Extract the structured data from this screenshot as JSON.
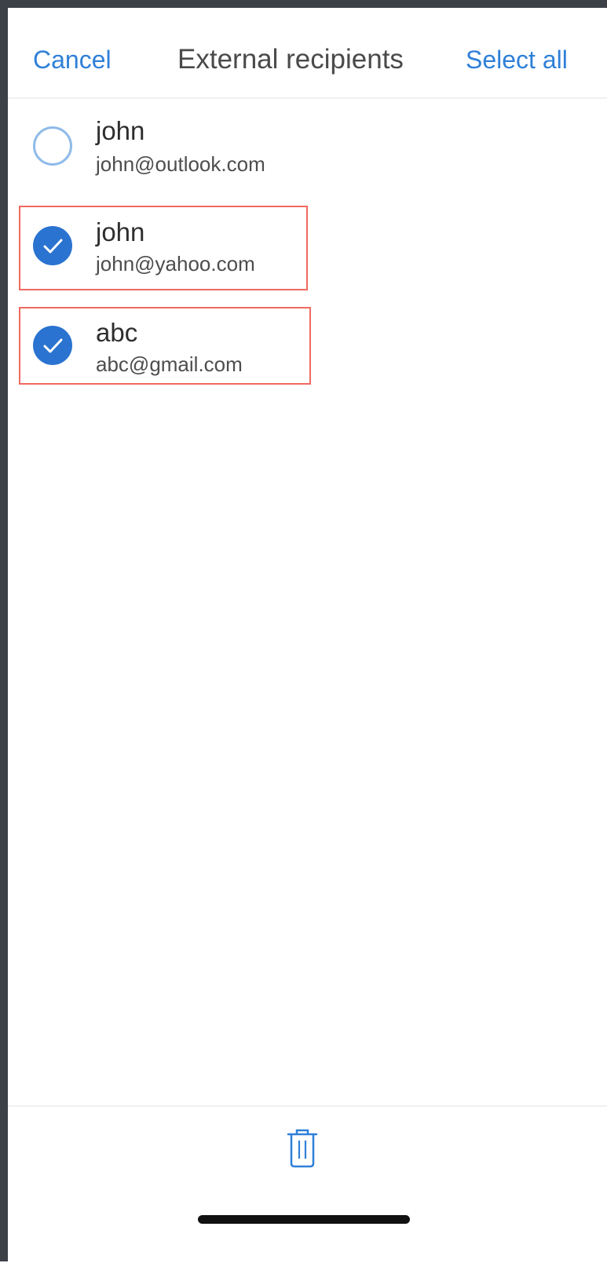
{
  "header": {
    "cancel_label": "Cancel",
    "title": "External recipients",
    "select_all_label": "Select all"
  },
  "recipients": [
    {
      "name": "john",
      "email": "john@outlook.com",
      "selected": false,
      "highlighted": false
    },
    {
      "name": "john",
      "email": "john@yahoo.com",
      "selected": true,
      "highlighted": true
    },
    {
      "name": "abc",
      "email": "abc@gmail.com",
      "selected": true,
      "highlighted": true
    }
  ],
  "toolbar": {
    "icon": "trash-icon"
  },
  "colors": {
    "accent": "#2f80d8",
    "checked": "#2a73d0",
    "highlight_border": "#f06a60",
    "device_frame": "#3c4147"
  }
}
